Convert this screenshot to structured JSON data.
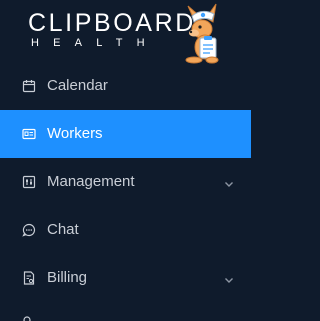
{
  "brand": {
    "wordmark": "CLIPBOARD",
    "subword": "HEALTH",
    "mascot_icon": "kangaroo-nurse-mascot"
  },
  "nav": {
    "items": [
      {
        "label": "Calendar",
        "icon": "calendar-icon",
        "active": false,
        "has_submenu": false
      },
      {
        "label": "Workers",
        "icon": "id-card-icon",
        "active": true,
        "has_submenu": false
      },
      {
        "label": "Management",
        "icon": "sliders-icon",
        "active": false,
        "has_submenu": true
      },
      {
        "label": "Chat",
        "icon": "chat-bubble-icon",
        "active": false,
        "has_submenu": false
      },
      {
        "label": "Billing",
        "icon": "invoice-icon",
        "active": false,
        "has_submenu": true
      }
    ]
  },
  "colors": {
    "sidebar_bg": "#0f1b2c",
    "active_bg": "#1e90ff",
    "text": "#c9ced6",
    "active_text": "#ffffff"
  }
}
